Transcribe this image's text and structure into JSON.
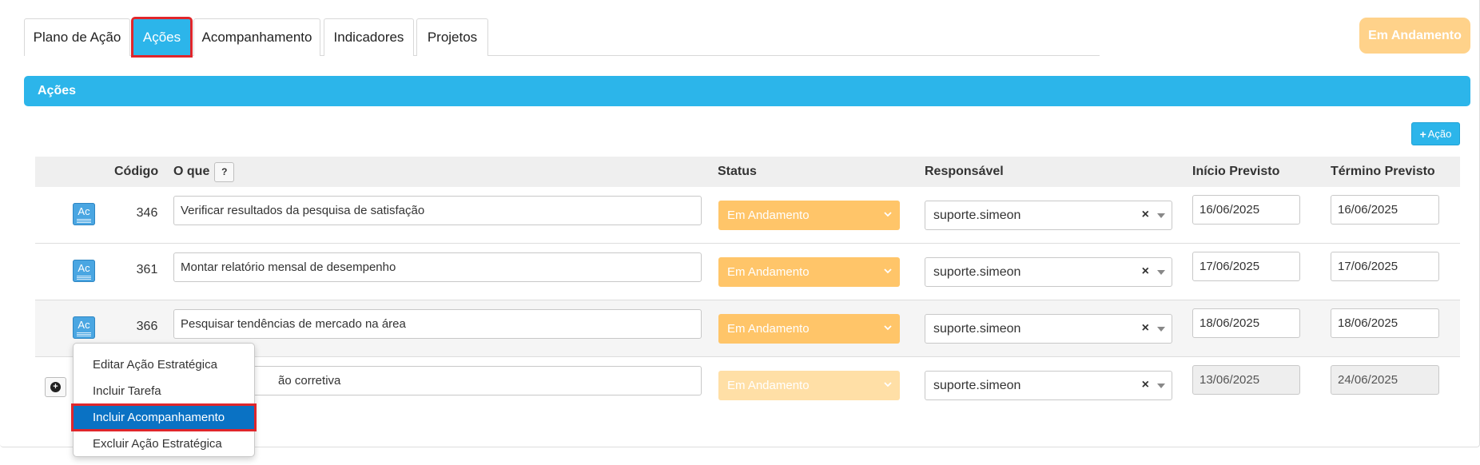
{
  "tabs": [
    {
      "label": "Plano de Ação"
    },
    {
      "label": "Ações"
    },
    {
      "label": "Acompanhamento"
    },
    {
      "label": "Indicadores"
    },
    {
      "label": "Projetos"
    }
  ],
  "status_pill": "Em Andamento",
  "section": {
    "title": "Ações"
  },
  "add_button": {
    "icon": "plus-icon",
    "label": "Ação"
  },
  "table": {
    "headers": {
      "codigo": "Código",
      "o_que": "O que",
      "help": "?",
      "status": "Status",
      "responsavel": "Responsável",
      "inicio": "Início Previsto",
      "termino": "Término Previsto"
    },
    "rows": [
      {
        "icon": "Ac",
        "code": "346",
        "what": "Verificar resultados da pesquisa de satisfação",
        "status": "Em Andamento",
        "responsible": "suporte.simeon",
        "start": "16/06/2025",
        "end": "16/06/2025"
      },
      {
        "icon": "Ac",
        "code": "361",
        "what": "Montar relatório mensal de desempenho",
        "status": "Em Andamento",
        "responsible": "suporte.simeon",
        "start": "17/06/2025",
        "end": "17/06/2025"
      },
      {
        "icon": "Ac",
        "code": "366",
        "what": "Pesquisar tendências de mercado na área",
        "status": "Em Andamento",
        "responsible": "suporte.simeon",
        "start": "18/06/2025",
        "end": "18/06/2025"
      },
      {
        "code": "",
        "what": "ão corretiva",
        "status": "Em Andamento",
        "responsible": "suporte.simeon",
        "start": "13/06/2025",
        "end": "24/06/2025"
      }
    ],
    "clear_glyph": "×"
  },
  "context_menu": {
    "items": [
      {
        "label": "Editar Ação Estratégica"
      },
      {
        "label": "Incluir Tarefa"
      },
      {
        "label": "Incluir Acompanhamento"
      },
      {
        "label": "Excluir Ação Estratégica"
      }
    ]
  },
  "colors": {
    "primary": "#2cb5ea",
    "status_orange": "#ffc569",
    "highlight_red": "#e0262b",
    "menu_selected": "#0a72c4"
  }
}
